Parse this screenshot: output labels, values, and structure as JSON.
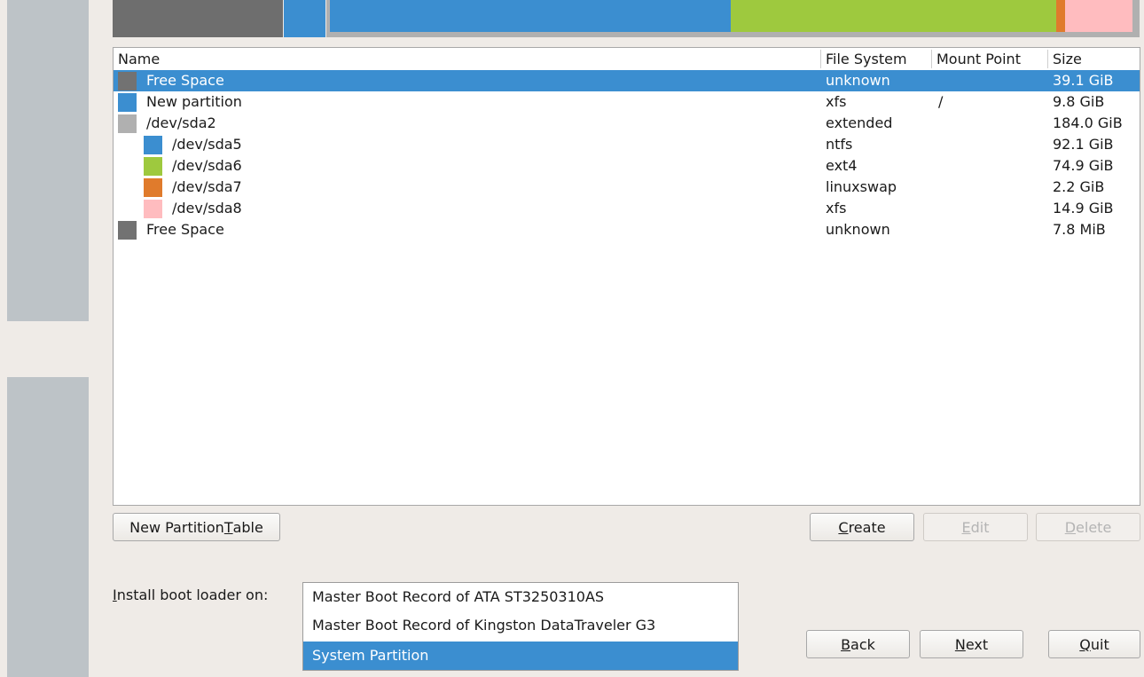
{
  "colors": {
    "selection": "#3b8ed0",
    "free_space": "#727272",
    "new_partition": "#3b8ed0",
    "extended": "#b0b0b0",
    "ntfs": "#3b8ed0",
    "ext4": "#9ec93e",
    "linuxswap": "#e07b2c",
    "xfs_pink": "#ffbcbf"
  },
  "columns": {
    "name": "Name",
    "filesystem": "File System",
    "mountpoint": "Mount Point",
    "size": "Size"
  },
  "partitions": [
    {
      "name": "Free Space",
      "filesystem": "unknown",
      "mountpoint": "",
      "size": "39.1 GiB",
      "color": "#727272",
      "selected": true
    },
    {
      "name": "New partition",
      "filesystem": "xfs",
      "mountpoint": "/",
      "size": "9.8 GiB",
      "color": "#3b8ed0"
    },
    {
      "name": "/dev/sda2",
      "filesystem": "extended",
      "mountpoint": "",
      "size": "184.0 GiB",
      "color": "#b0b0b0"
    },
    {
      "name": "/dev/sda5",
      "filesystem": "ntfs",
      "mountpoint": "",
      "size": "92.1 GiB",
      "color": "#3b8ed0"
    },
    {
      "name": "/dev/sda6",
      "filesystem": "ext4",
      "mountpoint": "",
      "size": "74.9 GiB",
      "color": "#9ec93e"
    },
    {
      "name": "/dev/sda7",
      "filesystem": "linuxswap",
      "mountpoint": "",
      "size": "2.2 GiB",
      "color": "#e07b2c"
    },
    {
      "name": "/dev/sda8",
      "filesystem": "xfs",
      "mountpoint": "",
      "size": "14.9 GiB",
      "color": "#ffbcbf"
    },
    {
      "name": "Free Space",
      "filesystem": "unknown",
      "mountpoint": "",
      "size": "7.8 MiB",
      "color": "#727272"
    }
  ],
  "buttons": {
    "new_partition_table": {
      "pre": "New Partition ",
      "ul": "T",
      "post": "able"
    },
    "create": {
      "pre": "",
      "ul": "C",
      "post": "reate"
    },
    "edit": {
      "pre": "",
      "ul": "E",
      "post": "dit"
    },
    "delete": {
      "pre": "",
      "ul": "D",
      "post": "elete"
    },
    "back": {
      "pre": "",
      "ul": "B",
      "post": "ack"
    },
    "next": {
      "pre": "",
      "ul": "N",
      "post": "ext"
    },
    "quit": {
      "pre": "",
      "ul": "Q",
      "post": "uit"
    }
  },
  "bootloader": {
    "label": {
      "pre": "",
      "ul": "I",
      "post": "nstall boot loader on:"
    },
    "options": [
      "Master Boot Record of ATA ST3250310AS",
      "Master Boot Record of Kingston DataTraveler G3",
      "System Partition"
    ],
    "selected": "System Partition"
  }
}
